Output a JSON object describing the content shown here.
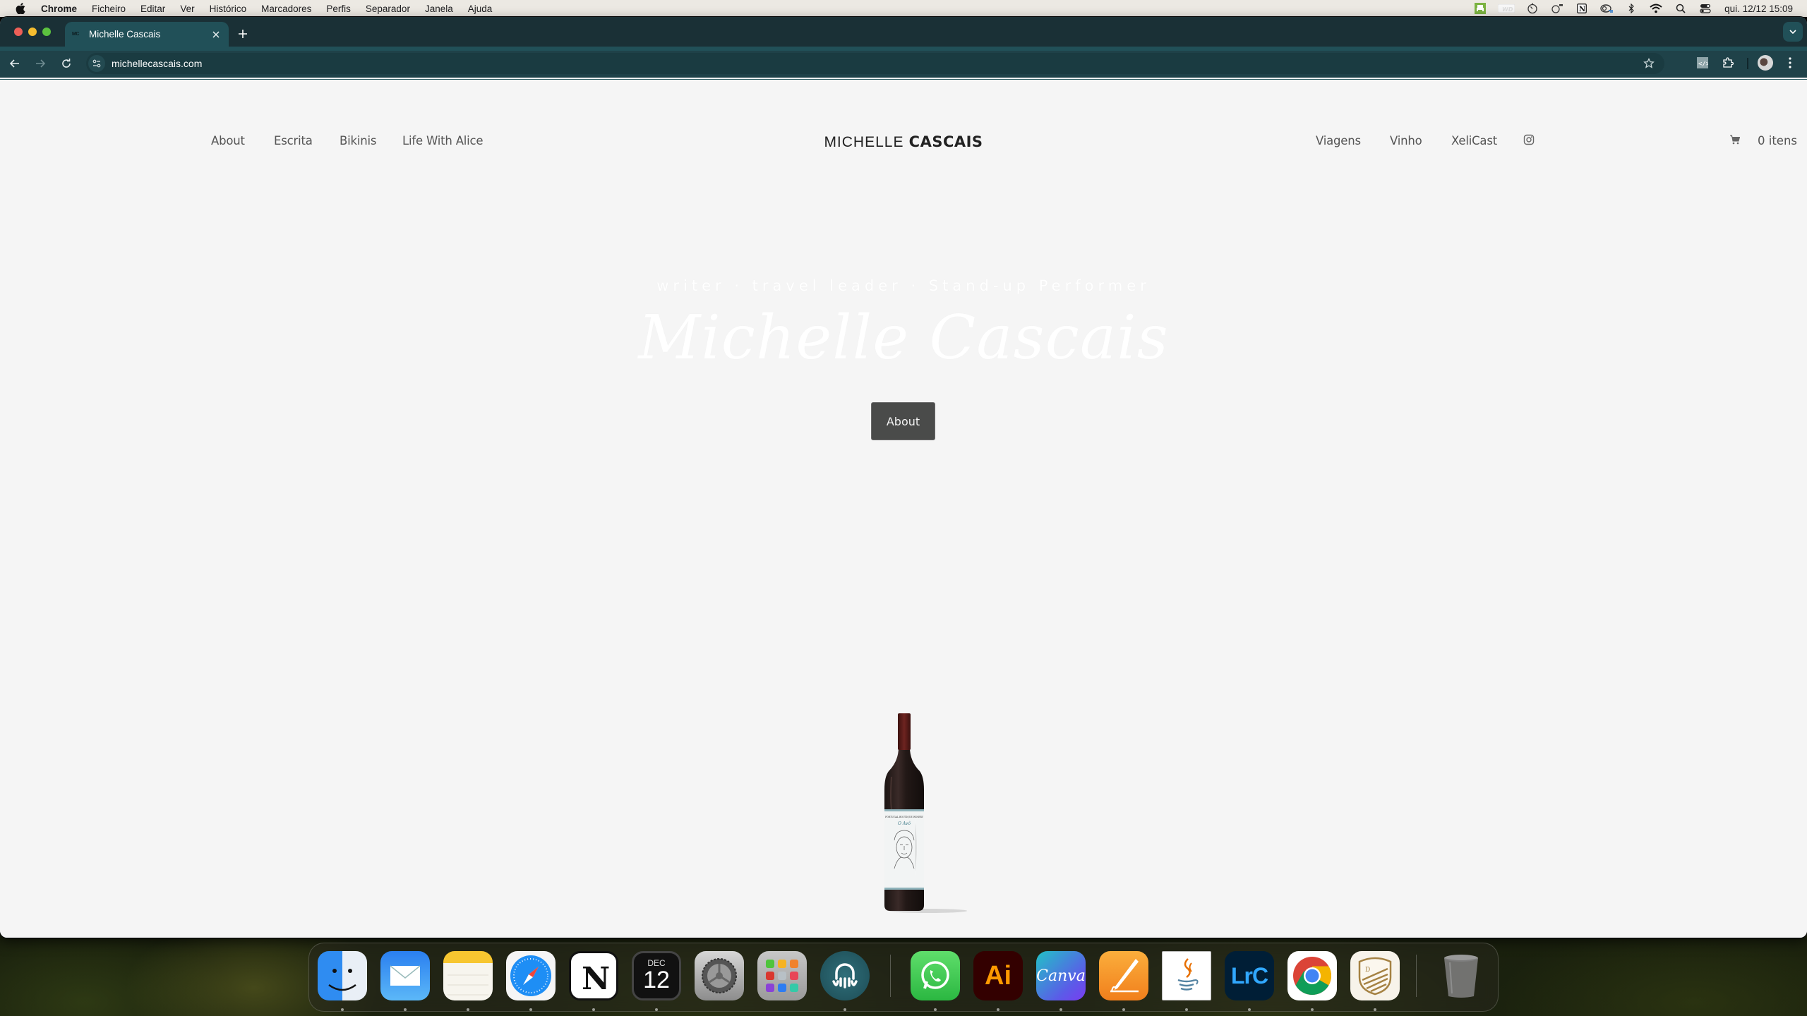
{
  "menubar": {
    "app_name": "Chrome",
    "items": [
      "Ficheiro",
      "Editar",
      "Ver",
      "Histórico",
      "Marcadores",
      "Perfis",
      "Separador",
      "Janela",
      "Ajuda"
    ],
    "status_icons": [
      "printer-app-icon",
      "wd-drive-icon",
      "timer-icon",
      "camo-icon",
      "notion-icon",
      "creative-cloud-icon",
      "bluetooth-icon",
      "wifi-icon",
      "spotlight-search-icon",
      "control-center-icon"
    ],
    "clock": "qui. 12/12  15:09"
  },
  "browser": {
    "tab": {
      "title": "Michelle Cascais",
      "favicon_text": "MC"
    },
    "url": "michellecascais.com"
  },
  "site": {
    "nav_left": [
      {
        "label": "About"
      },
      {
        "label": "Escrita"
      },
      {
        "label": "Bikinis"
      },
      {
        "label": "Life With Alice"
      }
    ],
    "logo": {
      "light": "MICHELLE",
      "bold": "CASCAIS"
    },
    "nav_right": [
      {
        "label": "Viagens"
      },
      {
        "label": "Vinho"
      },
      {
        "label": "XeliCast"
      }
    ],
    "cart_label": "0 itens",
    "hero": {
      "tagline": "writer · travel leader · Stand-up Performer",
      "title": "Michelle Cascais",
      "button_label": "About"
    },
    "product": {
      "winery": "PORTUGAL BOUTIQUE WINERY",
      "wine_name": "O Avô"
    }
  },
  "dock": {
    "apps": [
      {
        "name": "Finder",
        "running": true
      },
      {
        "name": "Mail",
        "running": true
      },
      {
        "name": "Notes",
        "running": true
      },
      {
        "name": "Safari",
        "running": true
      },
      {
        "name": "Notion",
        "running": true
      },
      {
        "name": "Calendar",
        "running": true,
        "month": "DEC",
        "day": "12"
      },
      {
        "name": "System Settings",
        "running": false
      },
      {
        "name": "Launchpad",
        "running": false
      },
      {
        "name": "Podcast App",
        "running": true
      },
      {
        "name": "WhatsApp",
        "running": true
      },
      {
        "name": "Adobe Illustrator",
        "running": true,
        "label": "Ai"
      },
      {
        "name": "Canva",
        "running": true,
        "label": "Canva"
      },
      {
        "name": "Pages",
        "running": true
      },
      {
        "name": "Java",
        "running": true
      },
      {
        "name": "Lightroom Classic",
        "running": true,
        "label": "LrC"
      },
      {
        "name": "Google Chrome",
        "running": true
      },
      {
        "name": "Shield App",
        "running": true,
        "label": "D"
      },
      {
        "name": "Trash",
        "running": false
      }
    ]
  },
  "colors": {
    "tabstrip": "#1a3036",
    "active_tab": "#215058",
    "toolbar": "#1f4249",
    "page_bg": "#f5f5f5",
    "button_bg": "#4a4b4a",
    "nav_text": "#555555"
  }
}
